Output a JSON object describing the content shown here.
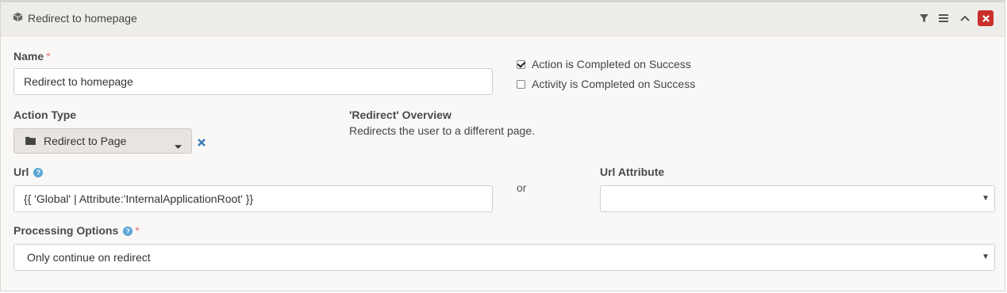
{
  "panel": {
    "title": "Redirect to homepage",
    "title_icon": "cube-icon",
    "header_icons": [
      "filter-icon",
      "menu-icon",
      "chevron-up-icon",
      "close-icon"
    ]
  },
  "name": {
    "label": "Name",
    "required_mark": "*",
    "value": "Redirect to homepage"
  },
  "options": {
    "action_completed": {
      "label": "Action is Completed on Success",
      "checked": true
    },
    "activity_completed": {
      "label": "Activity is Completed on Success",
      "checked": false
    }
  },
  "action_type": {
    "label": "Action Type",
    "value": "Redirect to Page",
    "icon": "folder-icon",
    "clear_icon": "clear-x-icon"
  },
  "overview": {
    "title": "'Redirect' Overview",
    "description": "Redirects the user to a different page."
  },
  "url": {
    "label": "Url",
    "help_icon": "help-icon",
    "value": "{{ 'Global' | Attribute:'InternalApplicationRoot' }}"
  },
  "or_text": "or",
  "url_attribute": {
    "label": "Url Attribute",
    "value": ""
  },
  "processing": {
    "label": "Processing Options",
    "required_mark": "*",
    "value": "Only continue on redirect"
  },
  "colors": {
    "close_button": "#c9302c",
    "required": "#e57373",
    "help": "#5aa6d6",
    "header_bg": "#efede9",
    "panel_bg": "#f9f8f6"
  }
}
